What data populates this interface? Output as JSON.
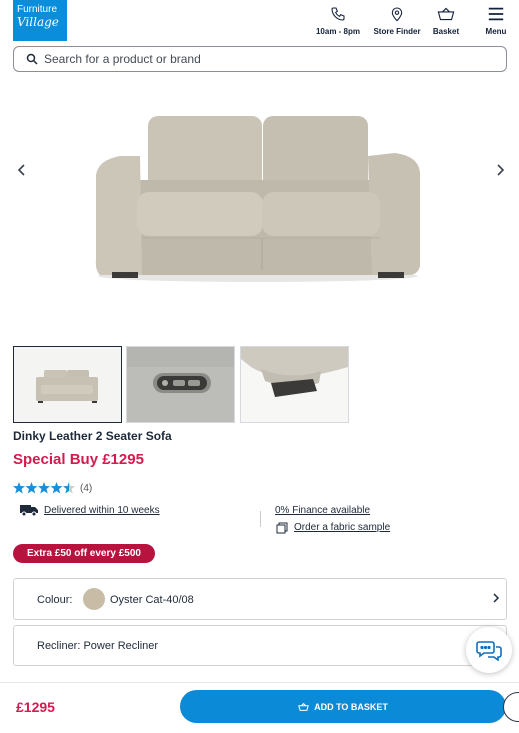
{
  "header": {
    "logo_line1": "Furniture",
    "logo_line2": "Village",
    "hours_label": "10am - 8pm",
    "store_finder_label": "Store Finder",
    "basket_label": "Basket",
    "menu_label": "Menu"
  },
  "search": {
    "placeholder": "Search for a product or brand"
  },
  "product": {
    "title": "Dinky Leather 2 Seater Sofa",
    "price_label": "Special Buy £1295",
    "rating_value": 4.5,
    "rating_max": 5,
    "review_count": "(4)",
    "delivery": "Delivered within 10 weeks",
    "finance": "0% Finance available",
    "sample": "Order a fabric sample",
    "promo": "Extra £50 off every £500"
  },
  "options": {
    "colour_label": "Colour:",
    "colour_value": "Oyster Cat-40/08",
    "colour_swatch": "#c8bca6",
    "recliner_label": "Recliner: Power Recliner"
  },
  "footer": {
    "price": "£1295",
    "add_to_basket": "ADD TO BASKET"
  },
  "colors": {
    "brand_blue": "#0a8ddb",
    "price_red": "#d41a4e",
    "promo_red": "#b8123f",
    "star_blue": "#1a8fd9"
  },
  "icons": [
    "phone-icon",
    "location-pin-icon",
    "basket-icon",
    "menu-icon",
    "search-icon",
    "chevron-left-icon",
    "chevron-right-icon",
    "star-icon",
    "truck-icon",
    "fabric-sample-icon",
    "chevron-right-icon",
    "chat-icon"
  ]
}
